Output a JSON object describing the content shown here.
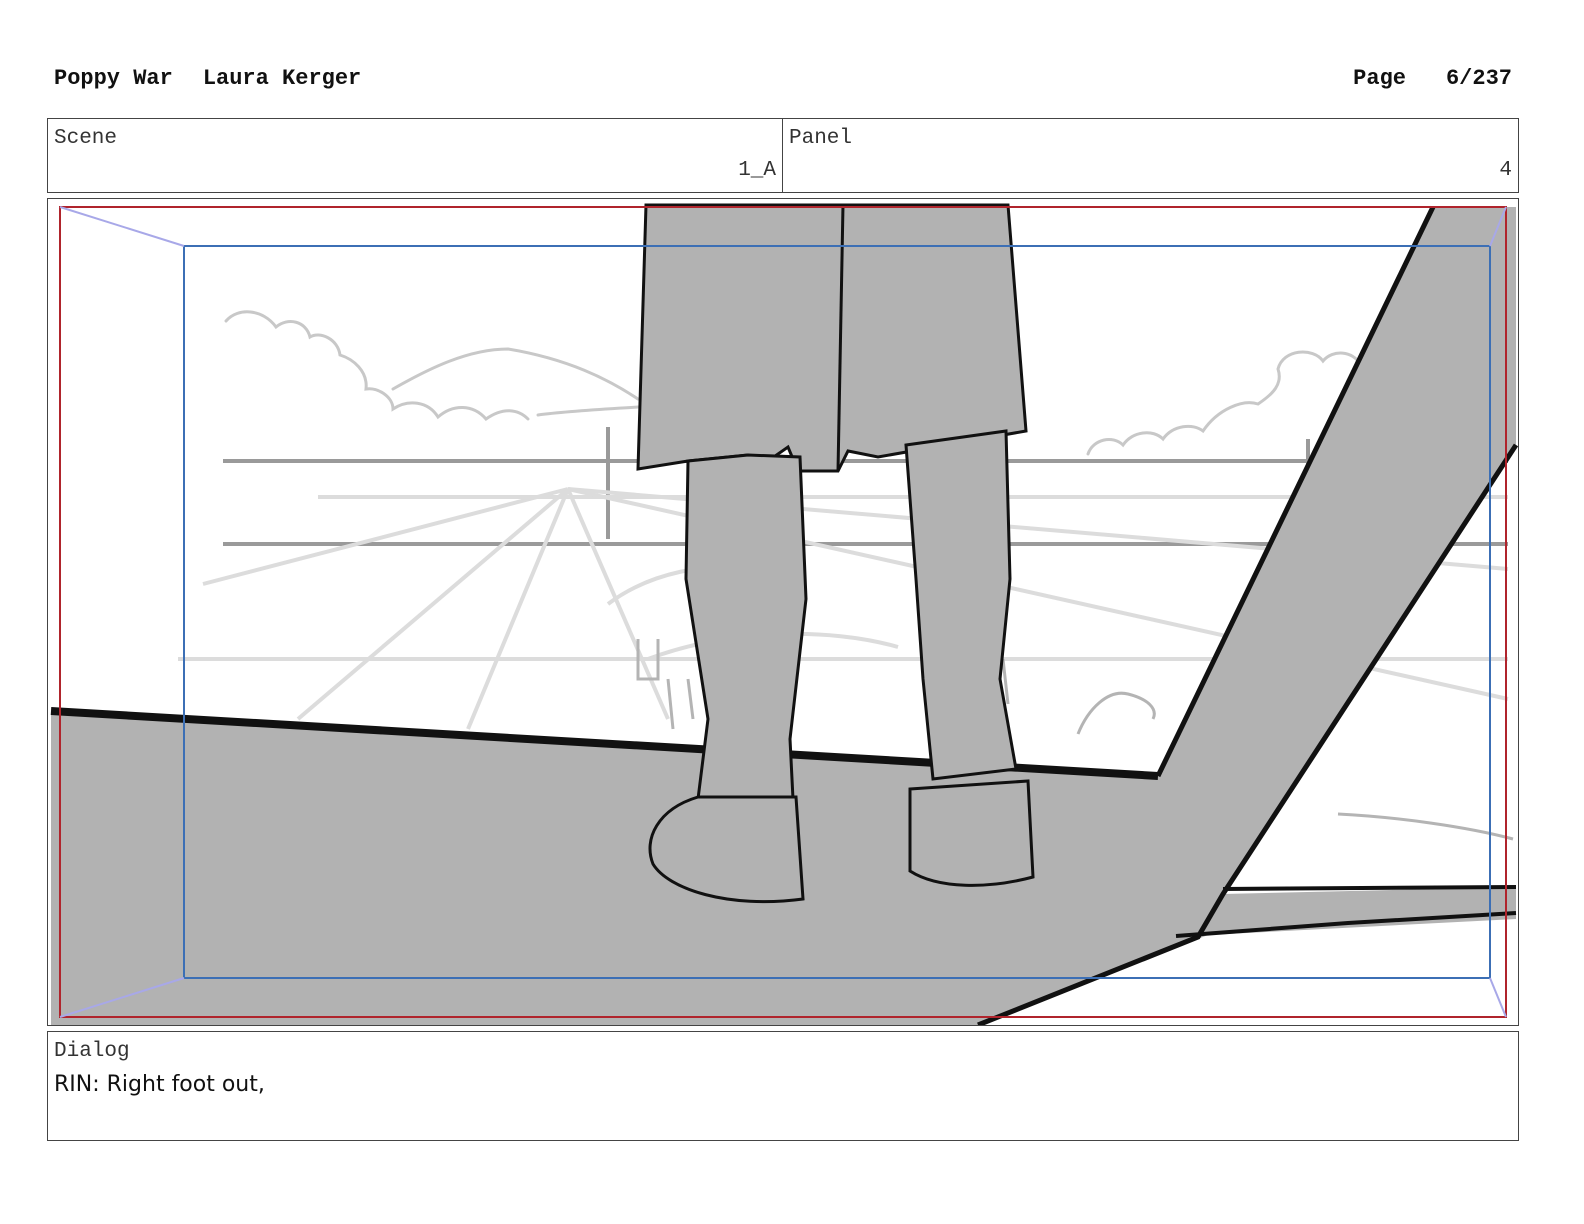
{
  "header": {
    "title": "Poppy War",
    "author": "Laura Kerger",
    "page_label": "Page",
    "page_number": "6/237"
  },
  "scene": {
    "label": "Scene",
    "value": "1_A"
  },
  "panel": {
    "label": "Panel",
    "value": "4"
  },
  "dialog": {
    "label": "Dialog",
    "text": "RIN: Right foot out,"
  },
  "colors": {
    "fill_gray": "#b2b2b2",
    "frame_red": "#b0242c",
    "safe_blue": "#3c6fb5",
    "sketch_gray": "#c8c8c8"
  }
}
